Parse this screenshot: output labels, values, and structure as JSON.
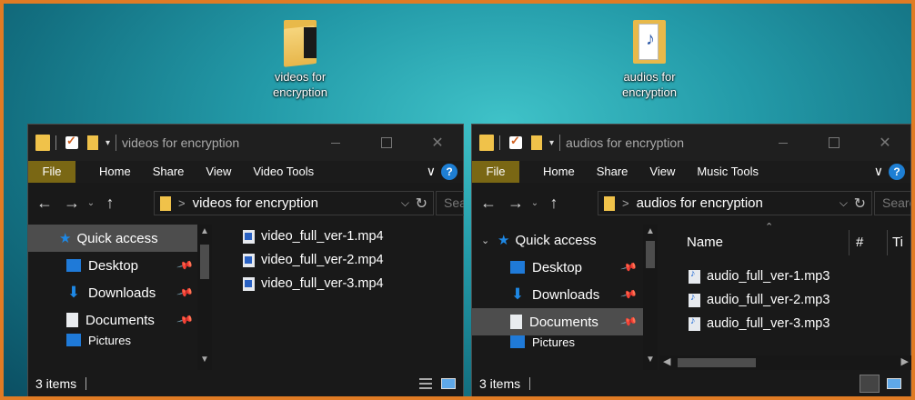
{
  "desktop": {
    "icons": [
      {
        "label": "videos for encryption",
        "icon": "video-folder-icon"
      },
      {
        "label": "audios for encryption",
        "icon": "audio-folder-icon"
      }
    ]
  },
  "windows": [
    {
      "title": "videos for encryption",
      "ribbon": {
        "file": "File",
        "home": "Home",
        "share": "Share",
        "view": "View",
        "tools": "Video Tools",
        "chevron": "∨",
        "help": "?"
      },
      "address": {
        "path": "videos for encryption",
        "separator": ">",
        "search_placeholder": "Search"
      },
      "nav": {
        "quick_access": "Quick access",
        "desktop": "Desktop",
        "downloads": "Downloads",
        "documents": "Documents",
        "pictures": "Pictures"
      },
      "files": [
        "video_full_ver-1.mp4",
        "video_full_ver-2.mp4",
        "video_full_ver-3.mp4"
      ],
      "status": "3 items"
    },
    {
      "title": "audios for encryption",
      "ribbon": {
        "file": "File",
        "home": "Home",
        "share": "Share",
        "view": "View",
        "tools": "Music Tools",
        "chevron": "∨",
        "help": "?"
      },
      "address": {
        "path": "audios for encryption",
        "separator": ">",
        "search_placeholder": "Search"
      },
      "nav": {
        "quick_access": "Quick access",
        "desktop": "Desktop",
        "downloads": "Downloads",
        "documents": "Documents",
        "pictures": "Pictures"
      },
      "columns": {
        "name": "Name",
        "number": "#",
        "title": "Ti"
      },
      "files": [
        "audio_full_ver-1.mp3",
        "audio_full_ver-2.mp3",
        "audio_full_ver-3.mp3"
      ],
      "status": "3 items"
    }
  ],
  "colors": {
    "accent_orange": "#e07b24",
    "file_tab": "#7a6714",
    "selected_bg": "#4d4d4d",
    "help_blue": "#1e7fd4"
  }
}
